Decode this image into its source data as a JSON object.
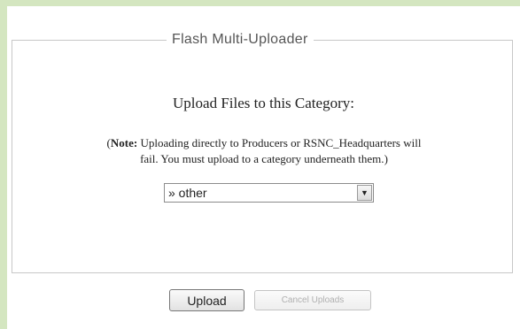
{
  "uploader": {
    "legend": "Flash Multi-Uploader",
    "heading": "Upload Files to this Category:",
    "note_label": "Note:",
    "note_text_line1": " Uploading directly to Producers or RSNC_Headquarters will",
    "note_text_line2": "fail. You must upload to a category underneath them.",
    "note_open": "(",
    "note_close": ")",
    "category_select": {
      "selected": "» other"
    },
    "upload_button": "Upload",
    "cancel_button": "Cancel Uploads"
  },
  "colors": {
    "page_background": "#d4e6c0",
    "panel_background": "#ffffff",
    "disabled_text": "#b0b0b0"
  },
  "icons": {
    "select_arrow": "chevron-down-icon"
  }
}
